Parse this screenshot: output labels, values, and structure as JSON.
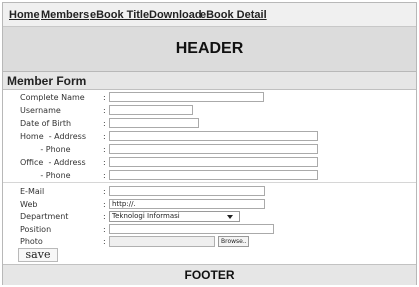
{
  "nav": {
    "home": "Home",
    "members": "Members",
    "ebook_title": "eBook Title",
    "download": "Download",
    "ebook_detail": "eBook Detail"
  },
  "header": {
    "title": "HEADER"
  },
  "form": {
    "title": "Member Form",
    "colon": ":",
    "labels": {
      "complete_name": "Complete Name",
      "username": "Username",
      "dob": "Date of Birth",
      "home_address": "Home  - Address",
      "home_phone": "        - Phone",
      "office_address": "Office  - Address",
      "office_phone": "        - Phone",
      "email": "E-Mail",
      "web": "Web",
      "department": "Department",
      "position": "Position",
      "photo": "Photo"
    },
    "values": {
      "web": "http://.",
      "department_selected": "Teknologi Informasi"
    },
    "browse_label": "Browse..",
    "save_label": "save"
  },
  "footer": {
    "title": "FOOTER"
  }
}
